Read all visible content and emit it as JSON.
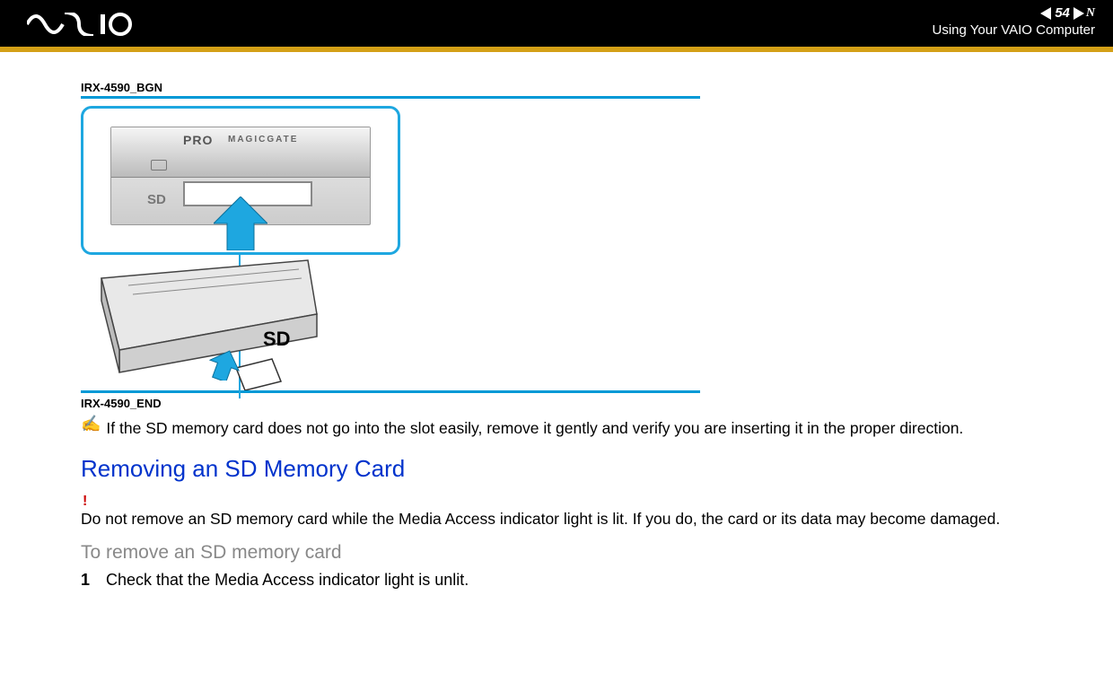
{
  "header": {
    "page_number": "54",
    "section_title": "Using Your VAIO Computer",
    "nav_letter": "N"
  },
  "figure": {
    "block_begin_label": "IRX-4590_BGN",
    "block_end_label": "IRX-4590_END",
    "callout": {
      "pro_label": "PRO",
      "magicgate_label": "MAGICGATE",
      "sd_label": "SD"
    },
    "laptop_sd_label": "SD"
  },
  "note": {
    "text": "If the SD memory card does not go into the slot easily, remove it gently and verify you are inserting it in the proper direction."
  },
  "heading_removing": "Removing an SD Memory Card",
  "warning": {
    "mark": "!",
    "text": "Do not remove an SD memory card while the Media Access indicator light is lit. If you do, the card or its data may become damaged."
  },
  "subheading_to_remove": "To remove an SD memory card",
  "steps": [
    {
      "num": "1",
      "text": "Check that the Media Access indicator light is unlit."
    }
  ]
}
